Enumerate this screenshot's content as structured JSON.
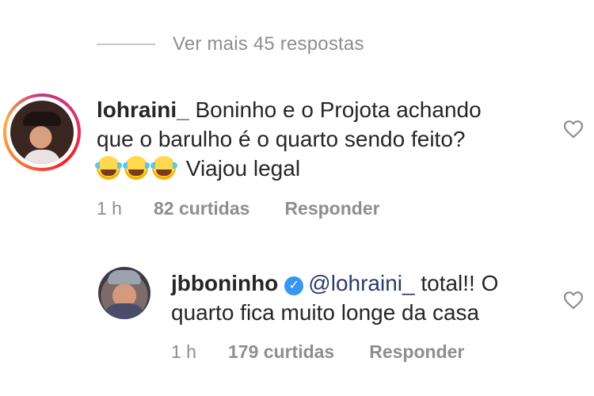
{
  "view_more": {
    "label": "Ver mais 45 respostas"
  },
  "comments": [
    {
      "username": "lohraini_",
      "line1": "Boninho e o Projota achando",
      "line2": "que o barulho é o quarto sendo feito?",
      "emojis": [
        "😂",
        "😂",
        "😂"
      ],
      "line3": "Viajou legal",
      "time": "1 h",
      "likes": "82 curtidas",
      "reply_label": "Responder",
      "avatar": "profile-photo-woman"
    },
    {
      "username": "jbboninho",
      "verified": true,
      "verified_icon": "verified-badge-icon",
      "mention": "@lohraini_",
      "line1_rest": " total!! O",
      "line2": "quarto fica muito longe da casa",
      "time": "1 h",
      "likes": "179 curtidas",
      "reply_label": "Responder",
      "avatar": "profile-photo-man"
    }
  ],
  "icons": {
    "like": "heart-outline-icon"
  },
  "colors": {
    "accent_blue": "#3897f0",
    "meta_gray": "#8e8e8e",
    "text": "#262626",
    "mention": "#2a3a6e"
  }
}
